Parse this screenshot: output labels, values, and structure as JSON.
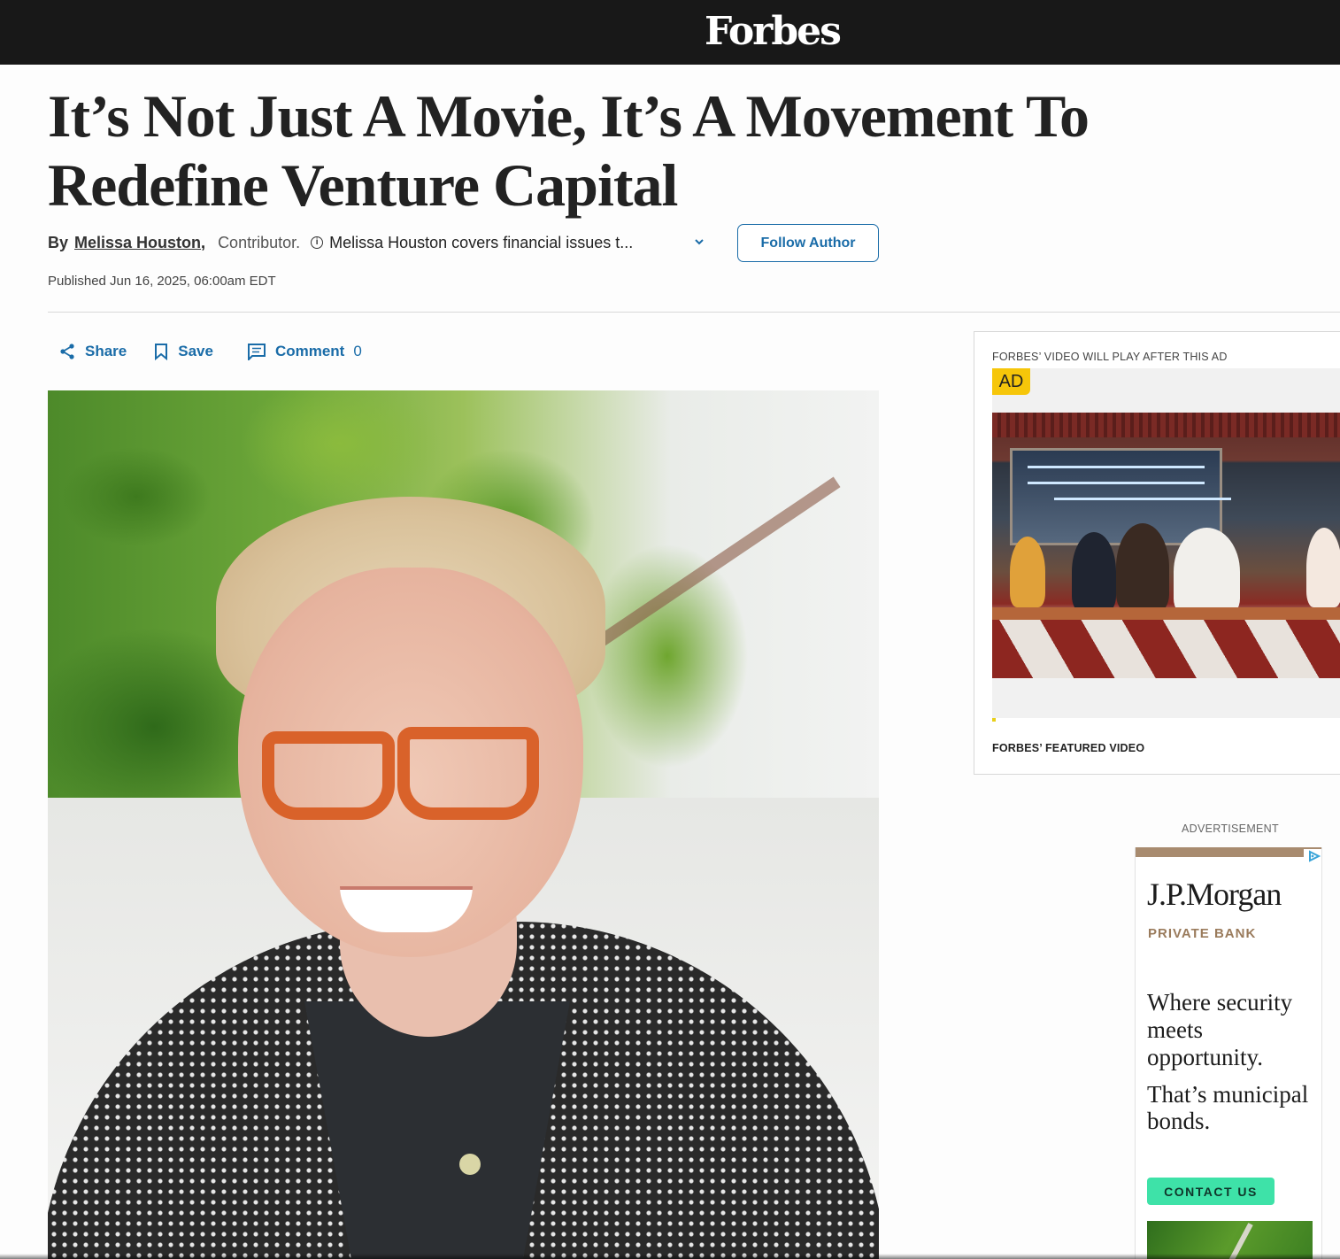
{
  "brand": {
    "logo_text": "Forbes"
  },
  "article": {
    "headline": "It’s Not Just A Movie, It’s A Movement To Redefine Venture Capital",
    "byline": {
      "by": "By",
      "author": "Melissa Houston",
      "comma": ",",
      "role": "Contributor.",
      "bio": "Melissa Houston covers financial issues t..."
    },
    "follow_label": "Follow Author",
    "published": "Published Jun 16, 2025, 06:00am EDT",
    "actions": {
      "share": "Share",
      "save": "Save",
      "comment": "Comment",
      "comment_count": "0"
    }
  },
  "video": {
    "caption": "FORBES’ VIDEO WILL PLAY AFTER THIS AD",
    "ad_badge": "AD",
    "featured_label": "FORBES’ FEATURED VIDEO",
    "progress": 0.01
  },
  "advertisement": {
    "label": "ADVERTISEMENT",
    "brand": "J.P.Morgan",
    "subbrand": "PRIVATE BANK",
    "copy_1": "Where security meets opportunity.",
    "copy_2": "That’s municipal bonds.",
    "cta": "CONTACT US"
  },
  "colors": {
    "topbar": "#181818",
    "link_blue": "#1a6ca8",
    "ad_yellow": "#f6c60a",
    "cta_green": "#3ee2a8"
  },
  "icons": [
    "info-icon",
    "chevron-down-icon",
    "share-icon",
    "bookmark-icon",
    "comment-icon",
    "adchoices-icon"
  ]
}
